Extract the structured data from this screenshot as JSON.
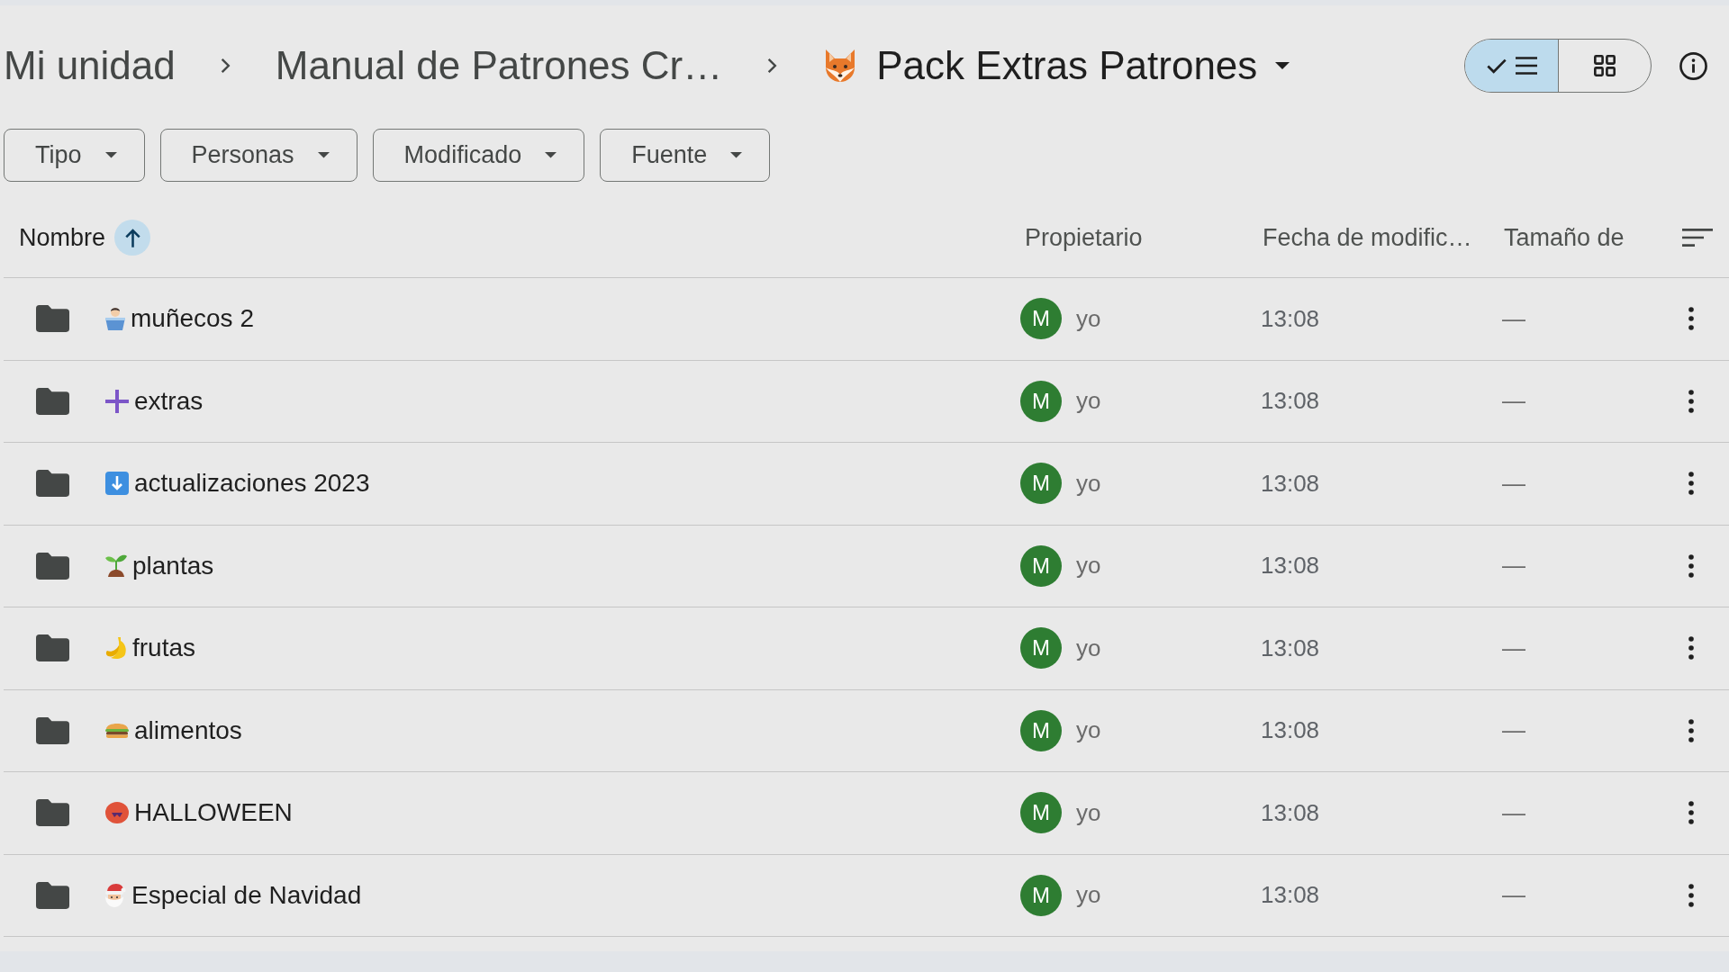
{
  "breadcrumb": [
    {
      "label": "Mi unidad",
      "current": false
    },
    {
      "label": "Manual de Patrones Cr…",
      "current": false
    },
    {
      "label": "Pack Extras Patrones",
      "current": true,
      "kind": "fox"
    }
  ],
  "view_options": [
    {
      "kind": "list",
      "selected": true
    },
    {
      "kind": "grid",
      "selected": false
    }
  ],
  "filters": [
    {
      "label": "Tipo"
    },
    {
      "label": "Personas"
    },
    {
      "label": "Modificado"
    },
    {
      "label": "Fuente"
    }
  ],
  "table": {
    "columns": [
      {
        "label": "Nombre",
        "sorted": true
      },
      {
        "label": "Propietario",
        "sorted": false
      },
      {
        "label": "Fecha de modific…",
        "sorted": false
      },
      {
        "label": "Tamaño de",
        "sorted": false
      }
    ],
    "rows": [
      {
        "kind": "figure",
        "name": "muñecos 2",
        "owner_initial": "M",
        "owner": "yo",
        "modified": "13:08",
        "size": "—"
      },
      {
        "kind": "plus",
        "name": "extras",
        "owner_initial": "M",
        "owner": "yo",
        "modified": "13:08",
        "size": "—"
      },
      {
        "kind": "download",
        "name": "actualizaciones 2023",
        "owner_initial": "M",
        "owner": "yo",
        "modified": "13:08",
        "size": "—"
      },
      {
        "kind": "sprout",
        "name": "plantas",
        "owner_initial": "M",
        "owner": "yo",
        "modified": "13:08",
        "size": "—"
      },
      {
        "kind": "banana",
        "name": "frutas",
        "owner_initial": "M",
        "owner": "yo",
        "modified": "13:08",
        "size": "—"
      },
      {
        "kind": "burger",
        "name": "alimentos",
        "owner_initial": "M",
        "owner": "yo",
        "modified": "13:08",
        "size": "—"
      },
      {
        "kind": "monster",
        "name": "HALLOWEEN",
        "owner_initial": "M",
        "owner": "yo",
        "modified": "13:08",
        "size": "—"
      },
      {
        "kind": "santa",
        "name": "Especial de Navidad",
        "owner_initial": "M",
        "owner": "yo",
        "modified": "13:08",
        "size": "—"
      }
    ]
  }
}
